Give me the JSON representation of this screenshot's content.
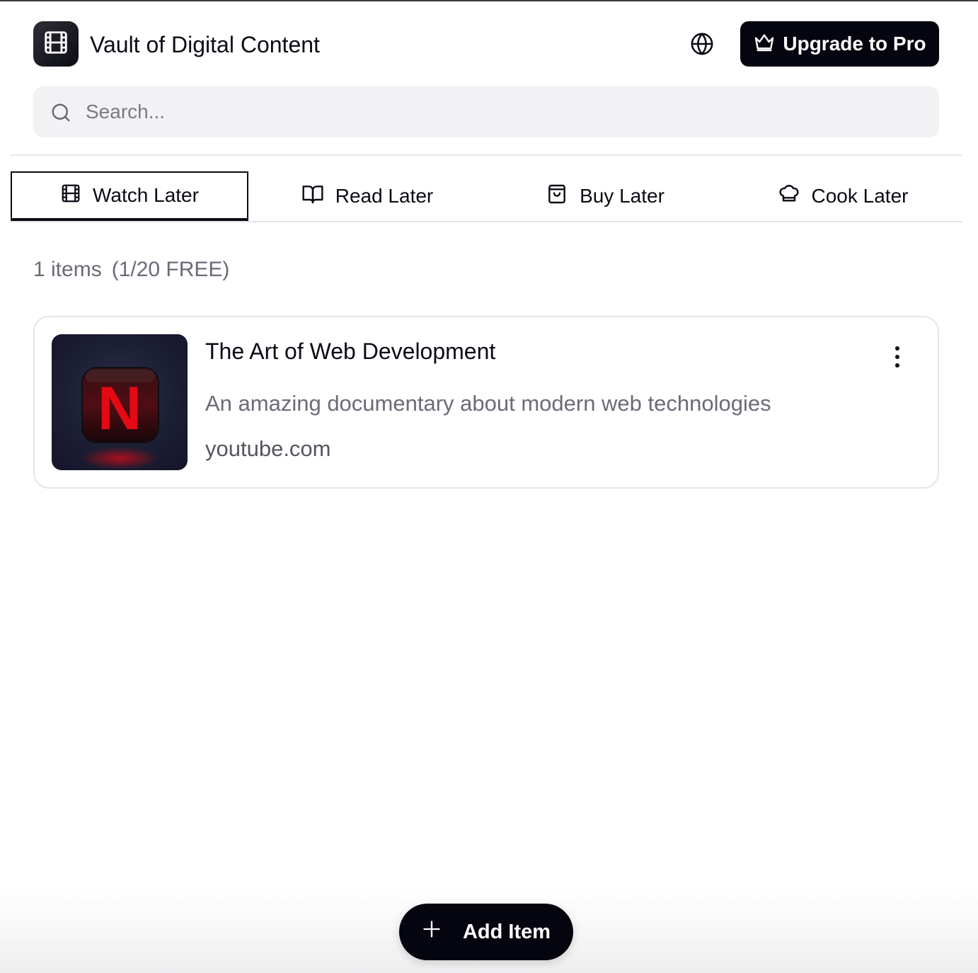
{
  "header": {
    "app_title": "Vault of Digital Content",
    "logo_icon": "film-icon",
    "language_icon": "globe-icon",
    "upgrade_label": "Upgrade to Pro",
    "upgrade_icon": "crown-icon"
  },
  "search": {
    "placeholder": "Search...",
    "value": "",
    "icon": "search-icon"
  },
  "tabs": [
    {
      "label": "Watch Later",
      "icon": "film-icon",
      "active": true
    },
    {
      "label": "Read Later",
      "icon": "book-open-icon",
      "active": false
    },
    {
      "label": "Buy Later",
      "icon": "shopping-bag-icon",
      "active": false
    },
    {
      "label": "Cook Later",
      "icon": "chef-hat-icon",
      "active": false
    }
  ],
  "summary": {
    "count_text": "1 items",
    "quota_text": "(1/20 FREE)"
  },
  "items": [
    {
      "title": "The Art of Web Development",
      "description": "An amazing documentary about modern web technologies",
      "domain": "youtube.com",
      "thumbnail_letter": "N",
      "menu_icon": "more-vertical-icon"
    }
  ],
  "fab": {
    "label": "Add Item",
    "icon": "plus-icon"
  },
  "colors": {
    "primary": "#05050f",
    "search_bg": "#f2f2f4",
    "muted_text": "#6b6b78",
    "netflix_red": "#e50914"
  }
}
